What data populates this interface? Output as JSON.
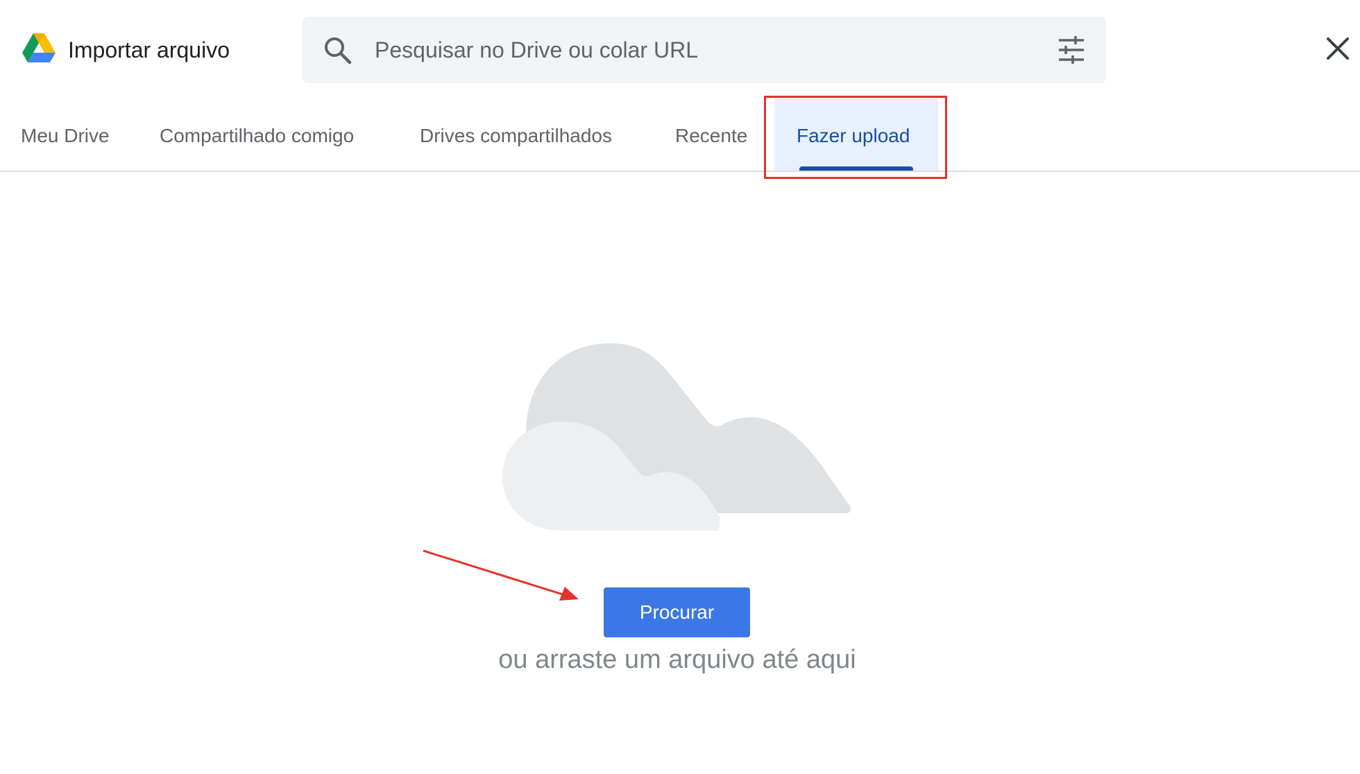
{
  "header": {
    "title": "Importar arquivo",
    "logo_icon": "google-drive-logo-icon"
  },
  "search": {
    "placeholder": "Pesquisar no Drive ou colar URL",
    "value": "",
    "search_icon": "search-icon",
    "filter_icon": "tune-filter-icon"
  },
  "close_icon": "close-icon",
  "tabs": [
    {
      "label": "Meu Drive",
      "active": false
    },
    {
      "label": "Compartilhado comigo",
      "active": false
    },
    {
      "label": "Drives compartilhados",
      "active": false
    },
    {
      "label": "Recente",
      "active": false
    },
    {
      "label": "Fazer upload",
      "active": true
    }
  ],
  "upload": {
    "button_label": "Procurar",
    "drop_hint": "ou arraste um arquivo até aqui"
  },
  "colors": {
    "accent": "#1a4fa0",
    "button": "#3b78e7",
    "annotation": "#e3332b",
    "tab_active_bg": "#e8f0fe"
  }
}
